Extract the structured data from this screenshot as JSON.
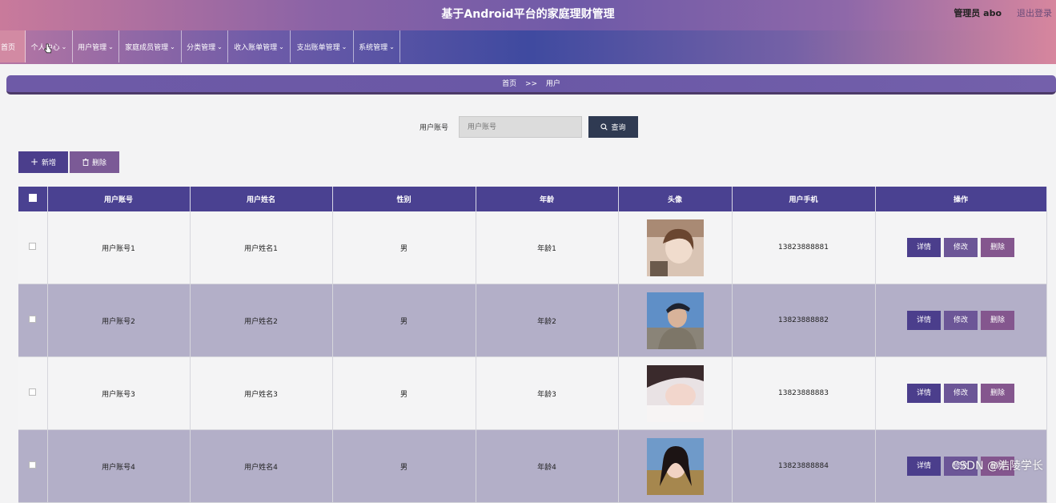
{
  "header": {
    "title": "基于Android平台的家庭理财管理",
    "user_label": "管理员 abo",
    "logout_label": "退出登录"
  },
  "nav": {
    "items": [
      {
        "label": "首页",
        "has_dropdown": false
      },
      {
        "label": "个人中心",
        "has_dropdown": true
      },
      {
        "label": "用户管理",
        "has_dropdown": true
      },
      {
        "label": "家庭成员管理",
        "has_dropdown": true
      },
      {
        "label": "分类管理",
        "has_dropdown": true
      },
      {
        "label": "收入账单管理",
        "has_dropdown": true
      },
      {
        "label": "支出账单管理",
        "has_dropdown": true
      },
      {
        "label": "系统管理",
        "has_dropdown": true
      }
    ]
  },
  "breadcrumb": {
    "home": "首页",
    "separator": ">>",
    "current": "用户"
  },
  "search": {
    "label": "用户账号",
    "placeholder": "用户账号",
    "button_label": "查询"
  },
  "actions": {
    "add_label": "新增",
    "delete_label": "删除"
  },
  "table": {
    "headers": [
      "用户账号",
      "用户姓名",
      "性别",
      "年龄",
      "头像",
      "用户手机",
      "操作"
    ],
    "rows": [
      {
        "account": "用户账号1",
        "name": "用户姓名1",
        "gender": "男",
        "age": "年龄1",
        "phone": "13823888881"
      },
      {
        "account": "用户账号2",
        "name": "用户姓名2",
        "gender": "男",
        "age": "年龄2",
        "phone": "13823888882"
      },
      {
        "account": "用户账号3",
        "name": "用户姓名3",
        "gender": "男",
        "age": "年龄3",
        "phone": "13823888883"
      },
      {
        "account": "用户账号4",
        "name": "用户姓名4",
        "gender": "男",
        "age": "年龄4",
        "phone": "13823888884"
      }
    ],
    "op_labels": {
      "detail": "详情",
      "edit": "修改",
      "delete": "删除"
    }
  },
  "watermark": "CSDN @浩陵学长",
  "colors": {
    "accent": "#4a4191",
    "search_button": "#2f3a52",
    "row_alt": "#b3afc8"
  }
}
